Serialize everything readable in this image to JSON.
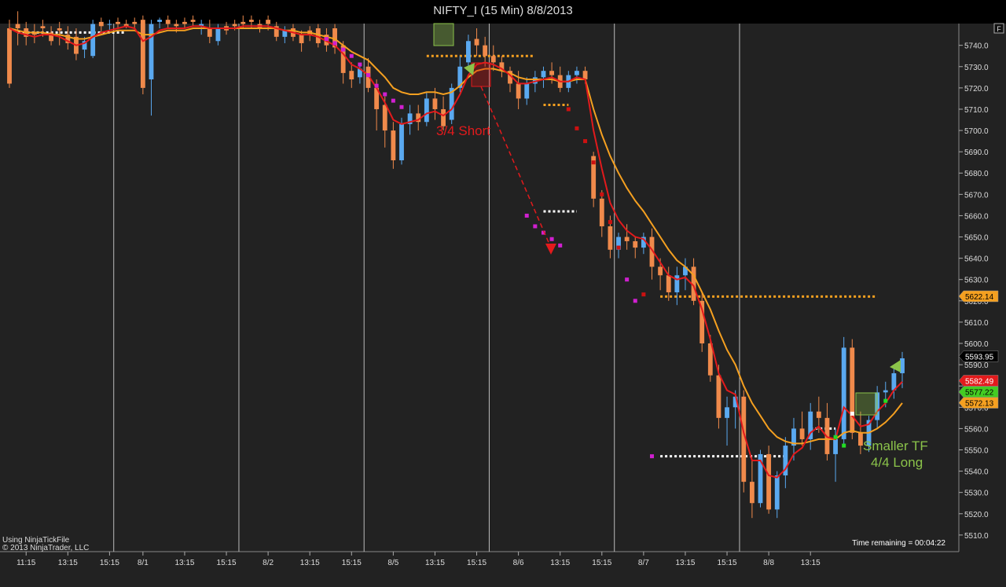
{
  "window": {
    "title": "NIFTY_I (15 Min)  8/8/2013"
  },
  "panel_button": "F",
  "footer": {
    "source": "Using NinjaTickFile",
    "copyright": "© 2013 NinjaTrader, LLC",
    "time_remaining": "Time remaining = 00:04:22"
  },
  "annotations": {
    "short": "3/4 Short",
    "long_line1": "Smaller TF",
    "long_line2": "4/4 Long"
  },
  "colors": {
    "background": "#222222",
    "bull": "#5aa9f0",
    "bear": "#f08a4b",
    "fast_ma": "#e31a1c",
    "slow_ma": "#f5a020",
    "long_note": "#8bc34a",
    "short_note": "#e31a1c"
  },
  "chart_data": {
    "type": "candlestick",
    "instrument": "NIFTY_I",
    "interval": "15 Min",
    "ylim": [
      5507,
      5748
    ],
    "y_ticks": [
      5510,
      5520,
      5530,
      5540,
      5550,
      5560,
      5570,
      5580,
      5590,
      5600,
      5610,
      5620,
      5630,
      5640,
      5650,
      5660,
      5670,
      5680,
      5690,
      5700,
      5710,
      5720,
      5730,
      5740
    ],
    "x_ticks": [
      {
        "i": 2,
        "label": "11:15"
      },
      {
        "i": 7,
        "label": "13:15"
      },
      {
        "i": 12,
        "label": "15:15"
      },
      {
        "i": 16,
        "label": "8/1"
      },
      {
        "i": 21,
        "label": "13:15"
      },
      {
        "i": 26,
        "label": "15:15"
      },
      {
        "i": 31,
        "label": "8/2"
      },
      {
        "i": 36,
        "label": "13:15"
      },
      {
        "i": 41,
        "label": "15:15"
      },
      {
        "i": 46,
        "label": "8/5"
      },
      {
        "i": 51,
        "label": "13:15"
      },
      {
        "i": 56,
        "label": "15:15"
      },
      {
        "i": 61,
        "label": "8/6"
      },
      {
        "i": 66,
        "label": "13:15"
      },
      {
        "i": 71,
        "label": "15:15"
      },
      {
        "i": 76,
        "label": "8/7"
      },
      {
        "i": 81,
        "label": "13:15"
      },
      {
        "i": 86,
        "label": "15:15"
      },
      {
        "i": 91,
        "label": "8/8"
      },
      {
        "i": 96,
        "label": "13:15"
      }
    ],
    "session_breaks": [
      12.5,
      27.5,
      42.5,
      57.5,
      72.5,
      87.5
    ],
    "candles": [
      [
        5748,
        5752,
        5720,
        5722
      ],
      [
        5750,
        5756,
        5740,
        5748
      ],
      [
        5748,
        5751,
        5740,
        5744
      ],
      [
        5746,
        5750,
        5741,
        5745
      ],
      [
        5749,
        5752,
        5744,
        5748
      ],
      [
        5746,
        5749,
        5740,
        5742
      ],
      [
        5748,
        5751,
        5740,
        5747
      ],
      [
        5745,
        5749,
        5738,
        5741
      ],
      [
        5744,
        5748,
        5733,
        5736
      ],
      [
        5738,
        5744,
        5734,
        5742
      ],
      [
        5735,
        5752,
        5734,
        5750
      ],
      [
        5751,
        5753,
        5745,
        5749
      ],
      [
        5750,
        5752,
        5747,
        5750
      ],
      [
        5751,
        5753,
        5748,
        5750
      ],
      [
        5750,
        5752,
        5748,
        5749
      ],
      [
        5751,
        5753,
        5748,
        5750
      ],
      [
        5752,
        5754,
        5717,
        5720
      ],
      [
        5724,
        5752,
        5707,
        5750
      ],
      [
        5751,
        5753,
        5748,
        5752
      ],
      [
        5752,
        5754,
        5748,
        5750
      ],
      [
        5750,
        5752,
        5746,
        5749
      ],
      [
        5751,
        5753,
        5748,
        5750
      ],
      [
        5752,
        5754,
        5749,
        5751
      ],
      [
        5749,
        5752,
        5745,
        5750
      ],
      [
        5748,
        5752,
        5741,
        5744
      ],
      [
        5742,
        5750,
        5740,
        5748
      ],
      [
        5749,
        5751,
        5745,
        5747
      ],
      [
        5750,
        5752,
        5747,
        5749
      ],
      [
        5751,
        5754,
        5748,
        5750
      ],
      [
        5752,
        5754,
        5748,
        5751
      ],
      [
        5750,
        5752,
        5746,
        5748
      ],
      [
        5752,
        5754,
        5747,
        5750
      ],
      [
        5749,
        5751,
        5742,
        5744
      ],
      [
        5744,
        5749,
        5741,
        5747
      ],
      [
        5748,
        5750,
        5742,
        5744
      ],
      [
        5745,
        5747,
        5737,
        5741
      ],
      [
        5747,
        5749,
        5742,
        5745
      ],
      [
        5748,
        5750,
        5739,
        5741
      ],
      [
        5745,
        5748,
        5737,
        5740
      ],
      [
        5748,
        5750,
        5736,
        5739
      ],
      [
        5740,
        5742,
        5722,
        5727
      ],
      [
        5728,
        5732,
        5720,
        5724
      ],
      [
        5725,
        5731,
        5722,
        5729
      ],
      [
        5730,
        5734,
        5718,
        5720
      ],
      [
        5720,
        5724,
        5700,
        5710
      ],
      [
        5712,
        5716,
        5692,
        5700
      ],
      [
        5700,
        5704,
        5682,
        5686
      ],
      [
        5686,
        5706,
        5684,
        5703
      ],
      [
        5703,
        5712,
        5698,
        5708
      ],
      [
        5708,
        5712,
        5700,
        5704
      ],
      [
        5704,
        5718,
        5702,
        5715
      ],
      [
        5715,
        5720,
        5705,
        5710
      ],
      [
        5710,
        5716,
        5700,
        5702
      ],
      [
        5705,
        5722,
        5703,
        5720
      ],
      [
        5720,
        5735,
        5718,
        5730
      ],
      [
        5732,
        5745,
        5728,
        5742
      ],
      [
        5743,
        5748,
        5735,
        5740
      ],
      [
        5740,
        5744,
        5730,
        5735
      ],
      [
        5735,
        5740,
        5728,
        5732
      ],
      [
        5732,
        5735,
        5725,
        5728
      ],
      [
        5728,
        5730,
        5718,
        5722
      ],
      [
        5722,
        5728,
        5710,
        5715
      ],
      [
        5715,
        5725,
        5712,
        5722
      ],
      [
        5722,
        5728,
        5718,
        5725
      ],
      [
        5725,
        5730,
        5720,
        5728
      ],
      [
        5728,
        5732,
        5722,
        5726
      ],
      [
        5726,
        5730,
        5718,
        5720
      ],
      [
        5720,
        5728,
        5718,
        5726
      ],
      [
        5726,
        5730,
        5722,
        5728
      ],
      [
        5728,
        5730,
        5722,
        5724
      ],
      [
        5688,
        5690,
        5664,
        5668
      ],
      [
        5668,
        5672,
        5650,
        5655
      ],
      [
        5655,
        5660,
        5640,
        5644
      ],
      [
        5644,
        5652,
        5640,
        5650
      ],
      [
        5650,
        5656,
        5644,
        5648
      ],
      [
        5648,
        5650,
        5640,
        5645
      ],
      [
        5645,
        5652,
        5642,
        5650
      ],
      [
        5650,
        5654,
        5630,
        5636
      ],
      [
        5636,
        5640,
        5625,
        5632
      ],
      [
        5632,
        5636,
        5620,
        5624
      ],
      [
        5624,
        5636,
        5618,
        5632
      ],
      [
        5632,
        5640,
        5625,
        5636
      ],
      [
        5636,
        5640,
        5618,
        5620
      ],
      [
        5620,
        5624,
        5596,
        5600
      ],
      [
        5600,
        5604,
        5582,
        5585
      ],
      [
        5585,
        5590,
        5560,
        5565
      ],
      [
        5565,
        5575,
        5552,
        5570
      ],
      [
        5570,
        5578,
        5560,
        5575
      ],
      [
        5575,
        5578,
        5530,
        5535
      ],
      [
        5535,
        5545,
        5518,
        5525
      ],
      [
        5525,
        5550,
        5523,
        5548
      ],
      [
        5548,
        5552,
        5520,
        5522
      ],
      [
        5522,
        5540,
        5518,
        5538
      ],
      [
        5538,
        5556,
        5532,
        5552
      ],
      [
        5552,
        5565,
        5545,
        5560
      ],
      [
        5560,
        5568,
        5552,
        5555
      ],
      [
        5555,
        5572,
        5550,
        5568
      ],
      [
        5568,
        5575,
        5558,
        5565
      ],
      [
        5565,
        5572,
        5545,
        5548
      ],
      [
        5548,
        5560,
        5535,
        5555
      ],
      [
        5555,
        5603,
        5552,
        5598
      ],
      [
        5598,
        5602,
        5555,
        5558
      ],
      [
        5558,
        5568,
        5548,
        5552
      ],
      [
        5552,
        5566,
        5549,
        5564
      ],
      [
        5564,
        5580,
        5560,
        5577
      ],
      [
        5577,
        5582,
        5570,
        5578
      ],
      [
        5578,
        5590,
        5574,
        5586
      ],
      [
        5586,
        5596,
        5579,
        5593
      ]
    ],
    "fast_ma": [
      5748,
      5746,
      5745,
      5744,
      5745,
      5745,
      5744,
      5742,
      5740,
      5741,
      5744,
      5746,
      5747,
      5748,
      5749,
      5748,
      5742,
      5744,
      5747,
      5748,
      5748,
      5748,
      5749,
      5749,
      5748,
      5748,
      5748,
      5748,
      5749,
      5749,
      5749,
      5749,
      5748,
      5747,
      5746,
      5745,
      5745,
      5744,
      5742,
      5740,
      5736,
      5731,
      5729,
      5726,
      5720,
      5713,
      5705,
      5703,
      5704,
      5705,
      5708,
      5709,
      5707,
      5710,
      5717,
      5726,
      5731,
      5732,
      5731,
      5729,
      5726,
      5722,
      5722,
      5723,
      5724,
      5725,
      5723,
      5723,
      5725,
      5724,
      5700,
      5682,
      5666,
      5658,
      5653,
      5650,
      5649,
      5644,
      5638,
      5632,
      5630,
      5631,
      5627,
      5616,
      5602,
      5586,
      5578,
      5576,
      5558,
      5545,
      5545,
      5538,
      5537,
      5541,
      5548,
      5551,
      5558,
      5561,
      5556,
      5555,
      5570,
      5566,
      5561,
      5562,
      5568,
      5572,
      5578,
      5582
    ],
    "slow_ma": [
      5748,
      5747,
      5746,
      5746,
      5746,
      5745,
      5745,
      5744,
      5743,
      5743,
      5744,
      5745,
      5746,
      5747,
      5747,
      5747,
      5745,
      5745,
      5746,
      5747,
      5747,
      5747,
      5748,
      5748,
      5748,
      5748,
      5748,
      5748,
      5748,
      5748,
      5748,
      5748,
      5748,
      5747,
      5747,
      5746,
      5746,
      5745,
      5744,
      5743,
      5740,
      5737,
      5735,
      5733,
      5729,
      5725,
      5720,
      5718,
      5717,
      5717,
      5718,
      5718,
      5717,
      5718,
      5721,
      5725,
      5728,
      5729,
      5729,
      5728,
      5727,
      5725,
      5724,
      5724,
      5724,
      5724,
      5723,
      5723,
      5724,
      5724,
      5710,
      5698,
      5688,
      5680,
      5673,
      5667,
      5662,
      5656,
      5650,
      5644,
      5639,
      5636,
      5632,
      5624,
      5616,
      5606,
      5597,
      5590,
      5580,
      5572,
      5566,
      5560,
      5556,
      5554,
      5553,
      5553,
      5554,
      5555,
      5555,
      5555,
      5558,
      5559,
      5558,
      5558,
      5560,
      5563,
      5567,
      5572
    ],
    "levels": [
      {
        "x1": 1,
        "x2": 14,
        "price": 5746,
        "color": "#ffffff"
      },
      {
        "x1": 50,
        "x2": 63,
        "price": 5735,
        "color": "#f5a020"
      },
      {
        "x1": 64,
        "x2": 67,
        "price": 5712,
        "color": "#f5a020"
      },
      {
        "x1": 64,
        "x2": 68,
        "price": 5662,
        "color": "#ffffff"
      },
      {
        "x1": 78,
        "x2": 104,
        "price": 5622,
        "color": "#f5a020"
      },
      {
        "x1": 78,
        "x2": 93,
        "price": 5547,
        "color": "#ffffff"
      },
      {
        "x1": 96,
        "x2": 99,
        "price": 5560,
        "color": "#ffffff"
      }
    ],
    "dots": [
      {
        "i": 38,
        "price": 5743,
        "color": "#d020d0"
      },
      {
        "i": 39,
        "price": 5741,
        "color": "#d020d0"
      },
      {
        "i": 40,
        "price": 5738,
        "color": "#d020d0"
      },
      {
        "i": 41,
        "price": 5735,
        "color": "#d020d0"
      },
      {
        "i": 42,
        "price": 5731,
        "color": "#d020d0"
      },
      {
        "i": 43,
        "price": 5726,
        "color": "#d020d0"
      },
      {
        "i": 44,
        "price": 5721,
        "color": "#d020d0"
      },
      {
        "i": 45,
        "price": 5717,
        "color": "#d020d0"
      },
      {
        "i": 46,
        "price": 5714,
        "color": "#d020d0"
      },
      {
        "i": 47,
        "price": 5711,
        "color": "#d020d0"
      },
      {
        "i": 62,
        "price": 5660,
        "color": "#d020d0"
      },
      {
        "i": 63,
        "price": 5655,
        "color": "#d020d0"
      },
      {
        "i": 64,
        "price": 5652,
        "color": "#d020d0"
      },
      {
        "i": 65,
        "price": 5649,
        "color": "#d020d0"
      },
      {
        "i": 66,
        "price": 5646,
        "color": "#d020d0"
      },
      {
        "i": 67,
        "price": 5710,
        "color": "#cc1111"
      },
      {
        "i": 68,
        "price": 5701,
        "color": "#cc1111"
      },
      {
        "i": 69,
        "price": 5695,
        "color": "#cc1111"
      },
      {
        "i": 70,
        "price": 5685,
        "color": "#cc1111"
      },
      {
        "i": 71,
        "price": 5670,
        "color": "#cc1111"
      },
      {
        "i": 72,
        "price": 5657,
        "color": "#cc1111"
      },
      {
        "i": 73,
        "price": 5645,
        "color": "#cc1111"
      },
      {
        "i": 74,
        "price": 5630,
        "color": "#d020d0"
      },
      {
        "i": 75,
        "price": 5620,
        "color": "#d020d0"
      },
      {
        "i": 76,
        "price": 5623,
        "color": "#cc1111"
      },
      {
        "i": 77,
        "price": 5547,
        "color": "#d020d0"
      },
      {
        "i": 99,
        "price": 5556,
        "color": "#22dd22"
      },
      {
        "i": 100,
        "price": 5552,
        "color": "#22dd22"
      },
      {
        "i": 101,
        "price": 5567,
        "color": "#ffffff"
      },
      {
        "i": 105,
        "price": 5573,
        "color": "#22dd22"
      }
    ],
    "price_labels": [
      {
        "price": 5622.14,
        "text": "5622.14",
        "bg": "#f5a020",
        "fg": "#000000"
      },
      {
        "price": 5593.95,
        "text": "5593.95",
        "bg": "#000000",
        "fg": "#ffffff"
      },
      {
        "price": 5582.49,
        "text": "5582.49",
        "bg": "#e31a1c",
        "fg": "#ffffff"
      },
      {
        "price": 5577.22,
        "text": "5577.22",
        "bg": "#44cc22",
        "fg": "#000000"
      },
      {
        "price": 5572.13,
        "text": "5572.13",
        "bg": "#f5a020",
        "fg": "#000000"
      }
    ]
  }
}
